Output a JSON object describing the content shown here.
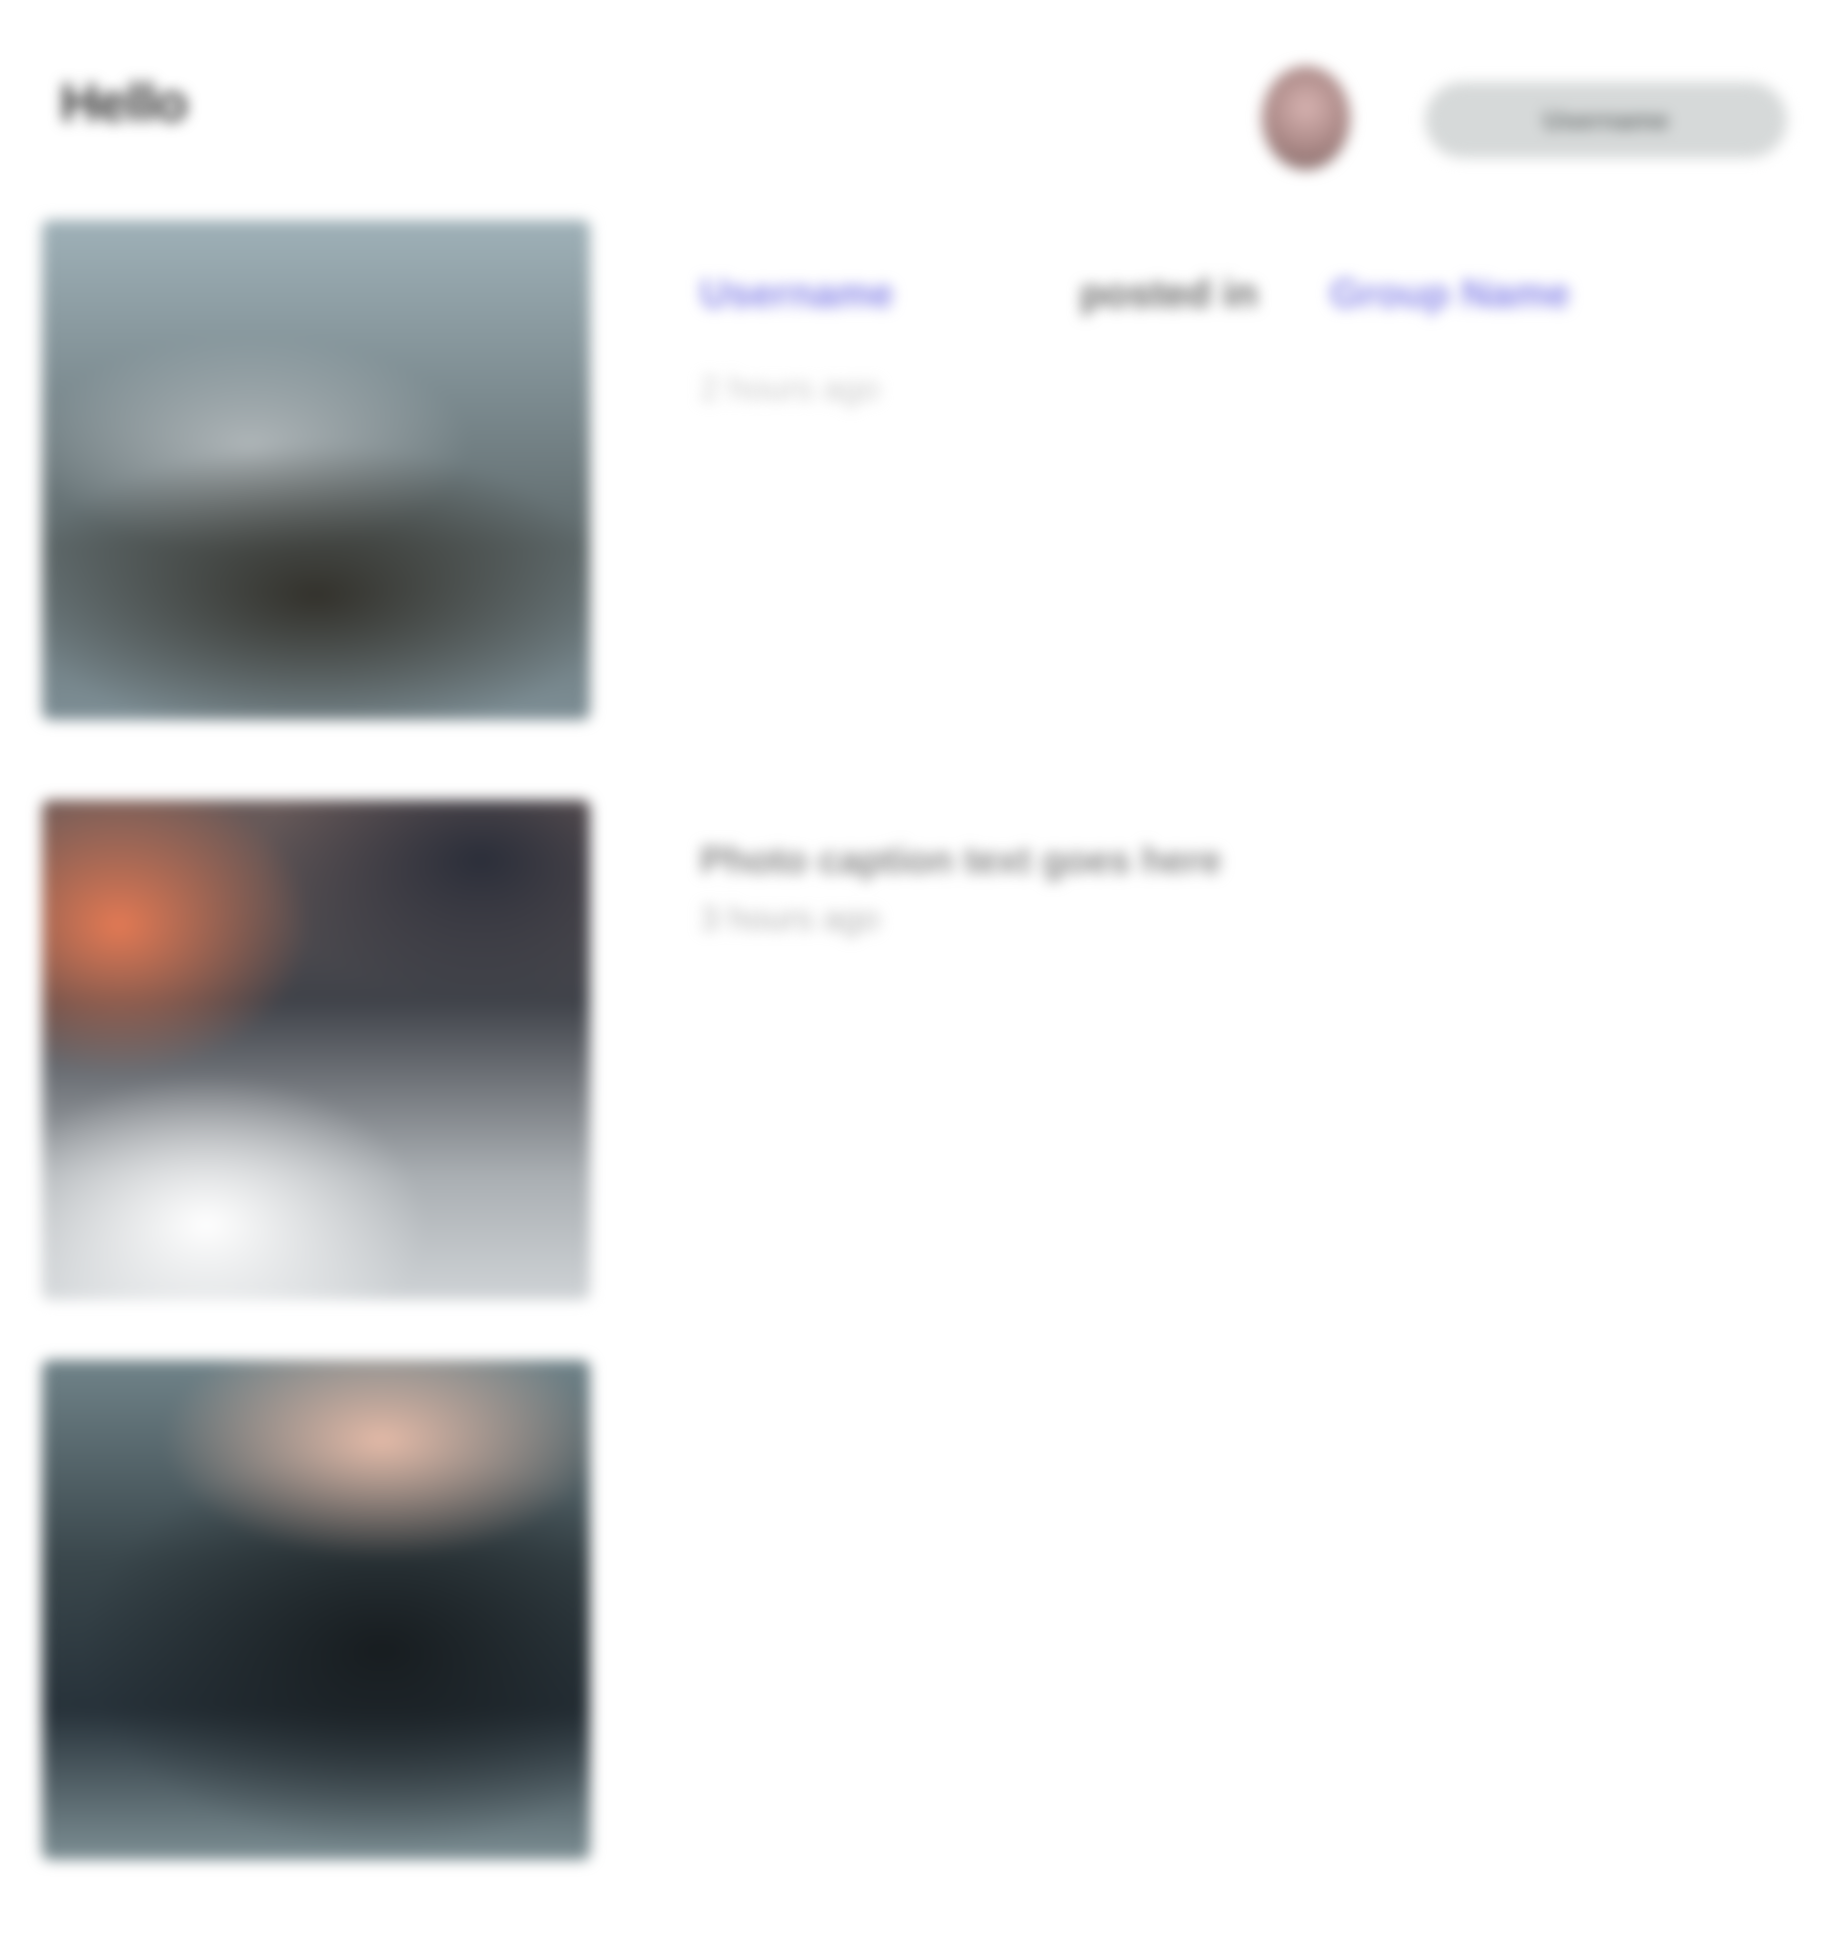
{
  "header": {
    "brand": "Hello",
    "user_name": "Username"
  },
  "feed": [
    {
      "author": "Username",
      "action": "posted in",
      "group": "Group Name",
      "time": "2 hours ago"
    },
    {
      "caption": "Photo caption text goes here",
      "time": "3 hours ago"
    },
    {}
  ],
  "colors": {
    "link": "#8a88e8",
    "pill": "#d6d9d9"
  }
}
